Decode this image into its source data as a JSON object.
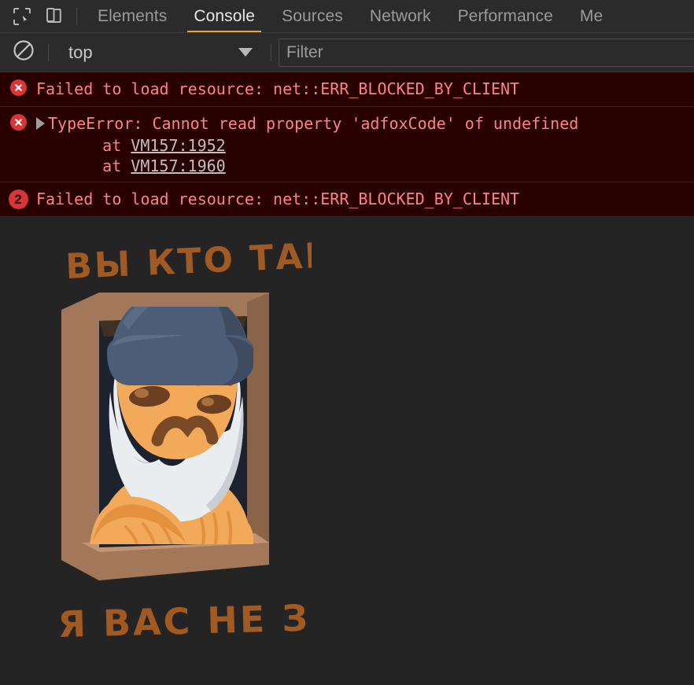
{
  "devtools": {
    "toolbar": {
      "inspect_icon": "inspect-element-icon",
      "device_toolbar_icon": "device-toolbar-icon"
    },
    "tabs": [
      {
        "label": "Elements",
        "active": false
      },
      {
        "label": "Console",
        "active": true
      },
      {
        "label": "Sources",
        "active": false
      },
      {
        "label": "Network",
        "active": false
      },
      {
        "label": "Performance",
        "active": false
      },
      {
        "label": "Me",
        "active": false
      }
    ],
    "active_tab": "Console",
    "accent_color": "#e8a33d"
  },
  "console_toolbar": {
    "clear_icon": "clear-console-icon",
    "context_value": "top",
    "chevron_icon": "chevron-down-icon",
    "filter_placeholder": "Filter",
    "filter_value": ""
  },
  "console_messages": [
    {
      "level": "error",
      "icon": "error-circle-icon",
      "text": "Failed to load resource: net::ERR_BLOCKED_BY_CLIENT",
      "count": null,
      "expandable": false,
      "stack": []
    },
    {
      "level": "error",
      "icon": "error-circle-icon",
      "text": "TypeError: Cannot read property 'adfoxCode' of undefined",
      "count": null,
      "expandable": true,
      "stack": [
        {
          "prefix": "    at ",
          "link": "VM157:1952"
        },
        {
          "prefix": "    at ",
          "link": "VM157:1960"
        }
      ]
    },
    {
      "level": "error",
      "icon": "count-badge",
      "text": "Failed to load resource: net::ERR_BLOCKED_BY_CLIENT",
      "count": "2",
      "expandable": false,
      "stack": []
    }
  ],
  "console_colors": {
    "error_background": "#290000",
    "error_text": "#ff8282",
    "error_border": "#5c1010",
    "error_icon": "#d93535",
    "link": "#bfbfbf"
  },
  "page": {
    "background": "#242424",
    "sticker": {
      "name": "grumpy-old-man-in-window-sticker",
      "top_caption": "ВЫ КТО ТАКИЕ ?",
      "bottom_caption": "Я ВАС НЕ ЗВАЛ",
      "caption_color": "#a05a22",
      "colors": {
        "frame_light": "#a3785a",
        "frame_mid": "#8f6a4d",
        "frame_dark": "#7b573e",
        "interior": "#1c222e",
        "skin": "#f3a95a",
        "skin_shadow": "#e3913f",
        "beard": "#e9edf0",
        "beard_shadow": "#c8ced4",
        "hat": "#4e5d77",
        "hat_dark": "#3e4b61",
        "brow": "#7a4a27"
      }
    }
  }
}
